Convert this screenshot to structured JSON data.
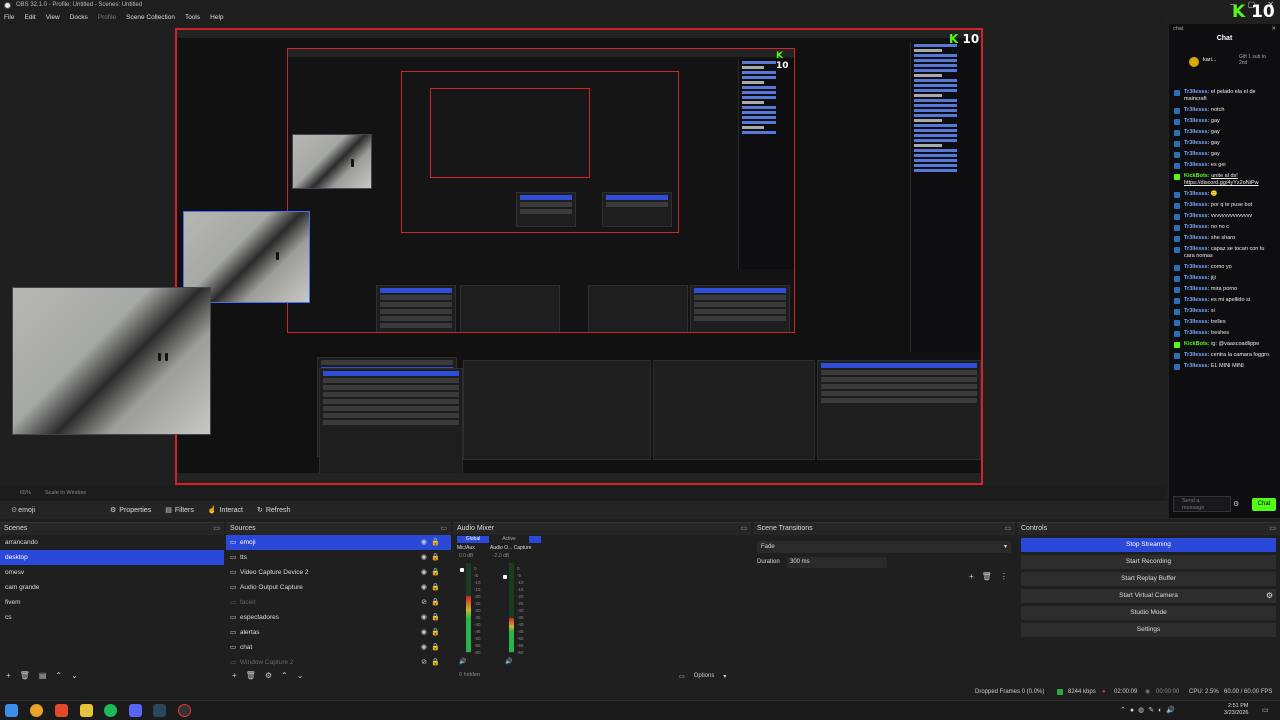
{
  "window": {
    "title": "OBS 32.1.0 - Profile: Untitled - Scenes: Untitled"
  },
  "menu": [
    "File",
    "Edit",
    "View",
    "Docks",
    "Profile",
    "Scene Collection",
    "Tools",
    "Help"
  ],
  "preview_overlay": {
    "kick_count": "10"
  },
  "view": {
    "zoom": "65%",
    "scale_mode": "Scale to Window"
  },
  "toolbar": {
    "source": "emoji",
    "properties": "Properties",
    "filters": "Filters",
    "interact": "Interact",
    "refresh": "Refresh"
  },
  "scenes": {
    "title": "Scenes",
    "items": [
      "arrancando",
      "desktop",
      "omesv",
      "cam grande",
      "fivem",
      "cs"
    ],
    "selected": 1
  },
  "sources": {
    "title": "Sources",
    "items": [
      {
        "name": "emoji",
        "sel": true,
        "hidden": false
      },
      {
        "name": "tts",
        "sel": false,
        "hidden": false
      },
      {
        "name": "Video Capture Device 2",
        "sel": false,
        "hidden": false
      },
      {
        "name": "Audio Output Capture",
        "sel": false,
        "hidden": false
      },
      {
        "name": "faceit",
        "sel": false,
        "hidden": true
      },
      {
        "name": "espectadores",
        "sel": false,
        "hidden": false
      },
      {
        "name": "alertas",
        "sel": false,
        "hidden": false
      },
      {
        "name": "chat",
        "sel": false,
        "hidden": false
      },
      {
        "name": "Window Capture 2",
        "sel": false,
        "hidden": true
      }
    ]
  },
  "audio_mixer": {
    "title": "Audio Mixer",
    "tab_global": "Global",
    "tab_active": "Active",
    "ch1": {
      "name": "Mic/Aux",
      "db": "0.0 dB",
      "level": 0.62
    },
    "ch2": {
      "name": "Audio O... Capture",
      "db": "-2.0 dB",
      "level": 0.38
    },
    "scale": [
      "0",
      "-5",
      "-10",
      "-15",
      "-20",
      "-25",
      "-30",
      "-35",
      "-40",
      "-45",
      "-50",
      "-55",
      "-60"
    ],
    "footer": "0 hidden"
  },
  "transitions": {
    "title": "Scene Transitions",
    "type": "Fade",
    "duration_label": "Duration",
    "duration": "300 ms"
  },
  "controls": {
    "title": "Controls",
    "stop_streaming": "Stop Streaming",
    "start_recording": "Start Recording",
    "start_replay": "Start Replay Buffer",
    "start_vcam": "Start Virtual Camera",
    "studio_mode": "Studio Mode",
    "settings": "Settings"
  },
  "dock_footer": {
    "options": "Options"
  },
  "status": {
    "dropped": "Dropped Frames 0 (0.0%)",
    "kbps": "8244 kbps",
    "time1": "02:00:09",
    "time2": "00:00:00",
    "cpu": "CPU: 2.5%",
    "fps": "60.00 / 60.00 FPS"
  },
  "chat": {
    "tab": "chat",
    "title": "Chat",
    "pinned_user": "kari...",
    "pinned_text": "Gift 1 sub to 2nd",
    "input_placeholder": "Send a message",
    "send": "Chat",
    "messages": [
      {
        "user": "Tr3llesss:",
        "text": "el pelado ela el de maincraft"
      },
      {
        "user": "Tr3llesss:",
        "text": "notch"
      },
      {
        "user": "Tr3llesss:",
        "text": "gay"
      },
      {
        "user": "Tr3llesss:",
        "text": "gay"
      },
      {
        "user": "Tr3llesss:",
        "text": "gay"
      },
      {
        "user": "Tr3llesss:",
        "text": "gay"
      },
      {
        "user": "Tr3llesss:",
        "text": "es gei"
      },
      {
        "user": "KickBots:",
        "text": "unite al ds! https://discord.gg/4yYz2oNiPw"
      },
      {
        "user": "Tr3llesss:",
        "text": "🙂"
      },
      {
        "user": "Tr3llesss:",
        "text": "por q te puse bot"
      },
      {
        "user": "Tr3llesss:",
        "text": "vvvvvvvvvvvvvvv"
      },
      {
        "user": "Tr3llesss:",
        "text": "no no c"
      },
      {
        "user": "Tr3llesss:",
        "text": "she sharo"
      },
      {
        "user": "Tr3llesss:",
        "text": "capaz se tocan con tu cara nomas"
      },
      {
        "user": "Tr3llesss:",
        "text": "como yo"
      },
      {
        "user": "Tr3llesss:",
        "text": "jiji"
      },
      {
        "user": "Tr3llesss:",
        "text": "mira porno"
      },
      {
        "user": "Tr3llesss:",
        "text": "es mi apellido si"
      },
      {
        "user": "Tr3llesss:",
        "text": "si"
      },
      {
        "user": "Tr3llesss:",
        "text": "trelles"
      },
      {
        "user": "Tr3llesss:",
        "text": "treshes"
      },
      {
        "user": "KickBots:",
        "text": "ig: @vaascoadlippe"
      },
      {
        "user": "Tr3llesss:",
        "text": "centra la camara foggro"
      },
      {
        "user": "Tr3llesss:",
        "text": "EL MINI MINI"
      }
    ]
  },
  "taskbar": {
    "time": "2:51 PM",
    "date": "3/23/2026"
  }
}
